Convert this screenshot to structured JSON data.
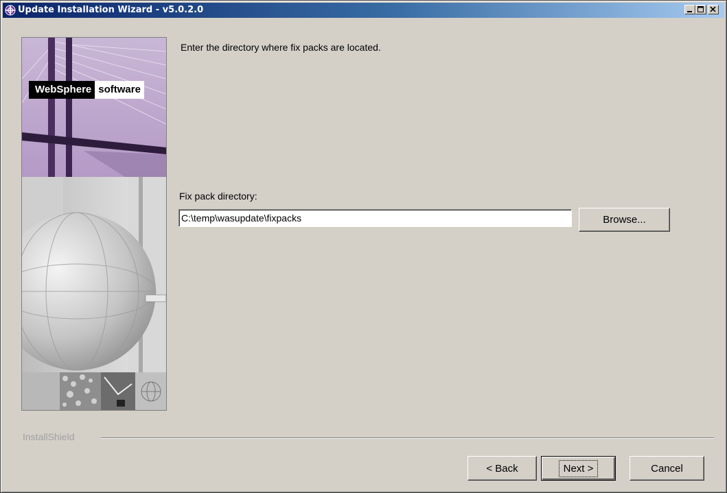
{
  "window": {
    "title": "Update Installation Wizard - v5.0.2.0"
  },
  "branding": {
    "logo_bold": "WebSphere",
    "logo_light": "software"
  },
  "main": {
    "instruction": "Enter the directory where fix packs are located.",
    "directory_label": "Fix pack directory:",
    "directory_value": "C:\\temp\\wasupdate\\fixpacks",
    "browse_label": "Browse..."
  },
  "footer": {
    "installer_brand": "InstallShield",
    "back_label": "< Back",
    "next_label": "Next >",
    "cancel_label": "Cancel"
  },
  "colors": {
    "titlebar_start": "#0a246a",
    "titlebar_end": "#a6caf0",
    "dialog_bg": "#d4d0c8",
    "image_tint": "#8a6aa0"
  },
  "icons": [
    "app-icon",
    "minimize-icon",
    "maximize-icon",
    "close-icon",
    "globe-icon"
  ]
}
